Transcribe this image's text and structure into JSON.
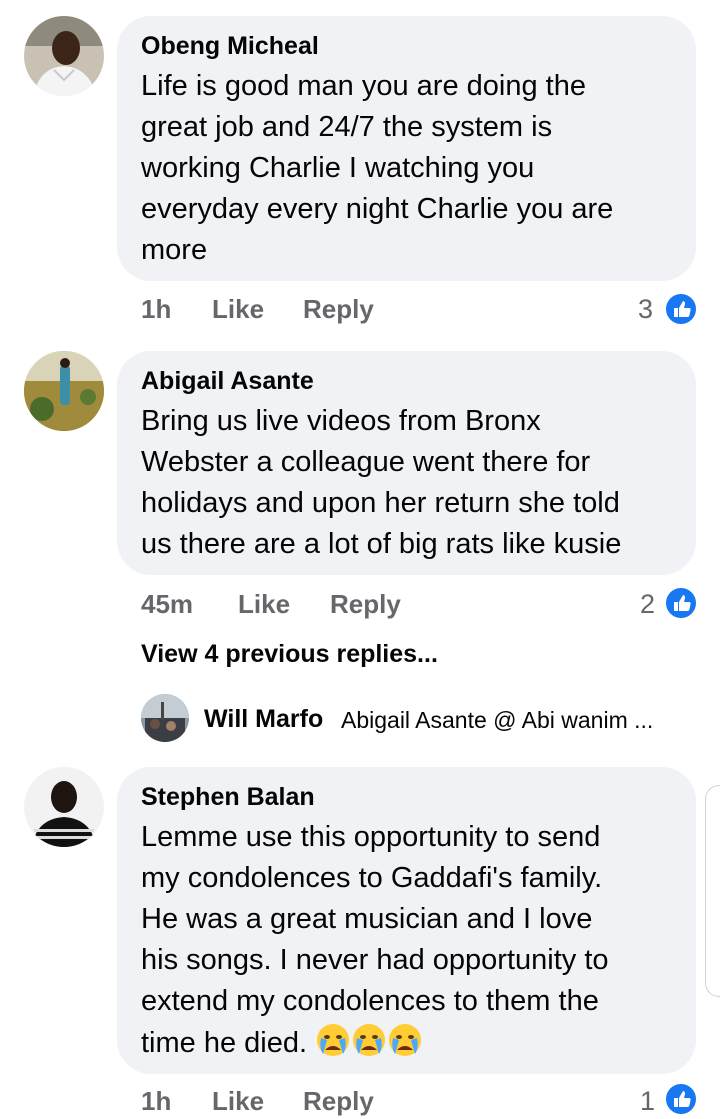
{
  "comments": [
    {
      "author": "Obeng Micheal",
      "lines": [
        "Life is good man you are doing the",
        "great job and 24/7 the system is",
        "working Charlie I watching you",
        "everyday every night Charlie you are",
        "more"
      ],
      "time": "1h",
      "like_label": "Like",
      "reply_label": "Reply",
      "like_count": "3"
    },
    {
      "author": "Abigail Asante",
      "lines": [
        "Bring us live videos from Bronx",
        "Webster a colleague went there for",
        "holidays and upon her return she told",
        "us there are a lot of big rats like kusie"
      ],
      "time": "45m",
      "like_label": "Like",
      "reply_label": "Reply",
      "like_count": "2",
      "view_previous_replies": "View 4 previous replies...",
      "reply_preview": {
        "author": "Will Marfo",
        "text": "Abigail Asante @ Abi wanim ..."
      }
    },
    {
      "author": "Stephen Balan",
      "lines": [
        "Lemme use this opportunity to send",
        "my condolences to Gaddafi's family.",
        "He was a great musician and I love",
        "his songs. I never had opportunity to",
        "extend my condolences to them the",
        "time he died."
      ],
      "time": "1h",
      "like_label": "Like",
      "reply_label": "Reply",
      "like_count": "1",
      "emoji": [
        "crying-face",
        "crying-face",
        "crying-face"
      ]
    }
  ],
  "colors": {
    "bubble": "#f0f2f5",
    "meta": "#65676b",
    "like_blue": "#1877f2",
    "text": "#050505"
  }
}
